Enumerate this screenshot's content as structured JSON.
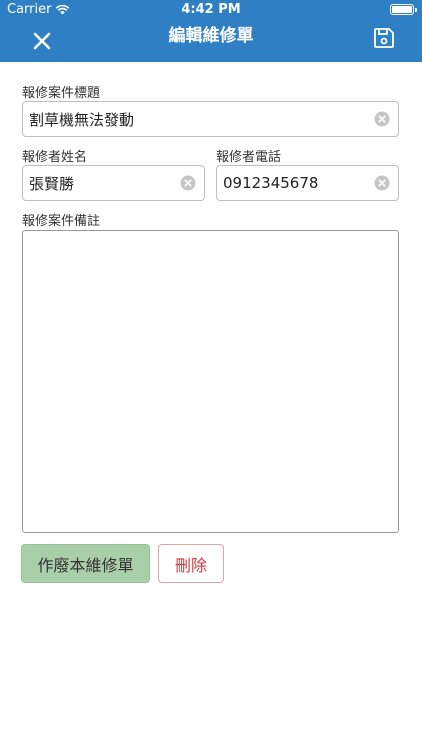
{
  "status_bar": {
    "carrier": "Carrier",
    "time": "4:42 PM"
  },
  "nav": {
    "title": "編輯維修單"
  },
  "form": {
    "case_title": {
      "label": "報修案件標題",
      "value": "割草機無法發動"
    },
    "reporter_name": {
      "label": "報修者姓名",
      "value": "張賢勝"
    },
    "reporter_phone": {
      "label": "報修者電話",
      "value": "0912345678"
    },
    "notes": {
      "label": "報修案件備註",
      "value": ""
    }
  },
  "actions": {
    "void_label": "作廢本維修單",
    "delete_label": "刪除"
  },
  "colors": {
    "header": "#2f7fc4",
    "void_button": "#a9cfa8",
    "delete_text": "#d03a3a"
  }
}
